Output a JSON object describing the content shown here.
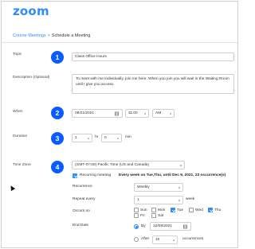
{
  "app": {
    "logo": "zoom"
  },
  "breadcrumb": {
    "parent": "Course Meetings",
    "separator": ">",
    "current": "Schedule a Meeting"
  },
  "steps": {
    "one": "1",
    "two": "2",
    "three": "3",
    "four": "4"
  },
  "topic": {
    "label": "Topic",
    "value": "Class Office Hours"
  },
  "description": {
    "label": "Description (Optional)",
    "value": "To meet with me individually, join me here. When you join you will wait in the Waiting Room until I give you access."
  },
  "when": {
    "label": "When",
    "date": "09/21/2021",
    "time": "11:00",
    "ampm": "AM"
  },
  "duration": {
    "label": "Duration",
    "hours": "1",
    "hours_unit": "hr",
    "minutes": "0",
    "minutes_unit": "min"
  },
  "timezone": {
    "label": "Time Zone",
    "value": "(GMT-07:00) Pacific Time (US and Canada)"
  },
  "recurring": {
    "checkbox_label": "Recurring meeting",
    "checked": true,
    "summary": "Every week on Tue,Thu, until Dec 9, 2021, 23 occurrence(s)",
    "recurrence_label": "Recurrence",
    "recurrence_value": "Weekly",
    "repeat_label": "Repeat every",
    "repeat_value": "1",
    "repeat_unit": "week",
    "occurs_label": "Occurs on",
    "days": [
      {
        "label": "Sun",
        "checked": false
      },
      {
        "label": "Mon",
        "checked": false
      },
      {
        "label": "Tue",
        "checked": true
      },
      {
        "label": "Wed",
        "checked": false
      },
      {
        "label": "Thu",
        "checked": true
      },
      {
        "label": "Fri",
        "checked": false
      },
      {
        "label": "Sat",
        "checked": false
      }
    ],
    "end_label": "End Date",
    "end_by_label": "By",
    "end_by_date": "12/09/2021",
    "end_after_label": "After",
    "end_after_value": "10",
    "end_after_unit": "occurrences",
    "end_option": "by"
  },
  "colors": {
    "brand": "#2d8cff",
    "badge": "#0b5cff"
  }
}
